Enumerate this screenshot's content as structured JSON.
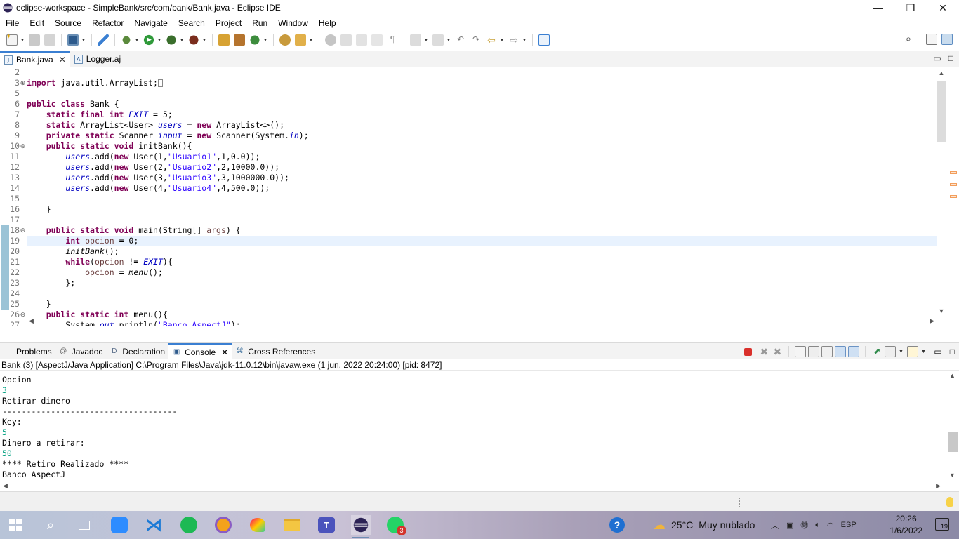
{
  "window": {
    "title": "eclipse-workspace - SimpleBank/src/com/bank/Bank.java - Eclipse IDE",
    "minimize": "—",
    "restore": "❐",
    "close": "✕"
  },
  "menu": [
    "File",
    "Edit",
    "Source",
    "Refactor",
    "Navigate",
    "Search",
    "Project",
    "Run",
    "Window",
    "Help"
  ],
  "editor_tabs": [
    {
      "label": "Bank.java",
      "active": true,
      "icon": "J"
    },
    {
      "label": "Logger.aj",
      "active": false,
      "icon": "A"
    }
  ],
  "editor": {
    "current_line": 19,
    "lines": [
      {
        "n": "2",
        "fold": "",
        "html": ""
      },
      {
        "n": "3",
        "fold": "⊕",
        "html": "<span class='kw'>import</span> java.util.ArrayList;<span style='border:1px solid #888;display:inline-block;width:7px;height:11px;vertical-align:middle'></span>"
      },
      {
        "n": "5",
        "fold": "",
        "html": ""
      },
      {
        "n": "6",
        "fold": "",
        "html": "<span class='kw'>public class</span> Bank {"
      },
      {
        "n": "7",
        "fold": "",
        "html": "    <span class='kw'>static final int</span> <span class='fld'>EXIT</span> = 5;"
      },
      {
        "n": "8",
        "fold": "",
        "html": "    <span class='kw'>static</span> ArrayList&lt;User&gt; <span class='fld'>users</span> = <span class='kw'>new</span> ArrayList&lt;&gt;();"
      },
      {
        "n": "9",
        "fold": "",
        "html": "    <span class='kw'>private static</span> Scanner <span class='fld'>input</span> = <span class='kw'>new</span> Scanner(System.<span class='fld'>in</span>);"
      },
      {
        "n": "10",
        "fold": "⊖",
        "html": "    <span class='kw'>public static void</span> initBank(){"
      },
      {
        "n": "11",
        "fold": "",
        "html": "        <span class='fld'>users</span>.add(<span class='kw'>new</span> User(1,<span class='str'>\"Usuario1\"</span>,1,0.0));"
      },
      {
        "n": "12",
        "fold": "",
        "html": "        <span class='fld'>users</span>.add(<span class='kw'>new</span> User(2,<span class='str'>\"Usuario2\"</span>,2,10000.0));"
      },
      {
        "n": "13",
        "fold": "",
        "html": "        <span class='fld'>users</span>.add(<span class='kw'>new</span> User(3,<span class='str'>\"Usuario3\"</span>,3,1000000.0));"
      },
      {
        "n": "14",
        "fold": "",
        "html": "        <span class='fld'>users</span>.add(<span class='kw'>new</span> User(4,<span class='str'>\"Usuario4\"</span>,4,500.0));"
      },
      {
        "n": "15",
        "fold": "",
        "html": ""
      },
      {
        "n": "16",
        "fold": "",
        "html": "    }"
      },
      {
        "n": "17",
        "fold": "",
        "html": ""
      },
      {
        "n": "18",
        "fold": "⊖",
        "html": "    <span class='kw'>public static void</span> main(String[] <span class='loc'>args</span>) {"
      },
      {
        "n": "19",
        "fold": "",
        "html": "        <span class='kw'>int</span> <span class='loc'>opcion</span> = 0;"
      },
      {
        "n": "20",
        "fold": "",
        "html": "        <span class='itl'>initBank</span>();"
      },
      {
        "n": "21",
        "fold": "",
        "html": "        <span class='kw'>while</span>(<span class='loc'>opcion</span> != <span class='fld'>EXIT</span>){"
      },
      {
        "n": "22",
        "fold": "",
        "html": "            <span class='loc'>opcion</span> = <span class='itl'>menu</span>();"
      },
      {
        "n": "23",
        "fold": "",
        "html": "        };"
      },
      {
        "n": "24",
        "fold": "",
        "html": ""
      },
      {
        "n": "25",
        "fold": "",
        "html": "    }"
      },
      {
        "n": "26",
        "fold": "⊖",
        "html": "    <span class='kw'>public static int</span> menu(){"
      },
      {
        "n": "27",
        "fold": "",
        "html": "        System.<span class='fld'>out</span>.println(<span class='str'>\"Banco AspectJ\"</span>);"
      }
    ]
  },
  "views": {
    "tabs": [
      {
        "label": "Problems",
        "icon": "!",
        "active": false
      },
      {
        "label": "Javadoc",
        "icon": "@",
        "active": false
      },
      {
        "label": "Declaration",
        "icon": "D",
        "active": false
      },
      {
        "label": "Console",
        "icon": "▣",
        "active": true
      },
      {
        "label": "Cross References",
        "icon": "⌘",
        "active": false
      }
    ],
    "close": "✕"
  },
  "console": {
    "title": "Bank (3) [AspectJ/Java Application] C:\\Program Files\\Java\\jdk-11.0.12\\bin\\javaw.exe  (1 jun. 2022 20:24:00) [pid: 8472]",
    "lines": [
      {
        "text": "------------------------------------",
        "input": false
      },
      {
        "text": "Opcion",
        "input": false
      },
      {
        "text": "3",
        "input": true
      },
      {
        "text": "Retirar dinero",
        "input": false
      },
      {
        "text": "------------------------------------",
        "input": false
      },
      {
        "text": "Key:",
        "input": false
      },
      {
        "text": "5",
        "input": true
      },
      {
        "text": "Dinero a retirar:",
        "input": false
      },
      {
        "text": "50",
        "input": true
      },
      {
        "text": "**** Retiro Realizado ****",
        "input": false
      },
      {
        "text": "Banco AspectJ",
        "input": false
      }
    ]
  },
  "taskbar": {
    "weather_temp": "25°C",
    "weather_desc": "Muy nublado",
    "lang": "ESP",
    "time": "20:26",
    "date": "1/6/2022",
    "notif_count": "19",
    "whatsapp_badge": "3"
  },
  "colors": {
    "keyword": "#7f0055",
    "field": "#0000c0",
    "string": "#2a00ff",
    "console_input": "#00a080",
    "tab_accent": "#3a7fd2"
  }
}
